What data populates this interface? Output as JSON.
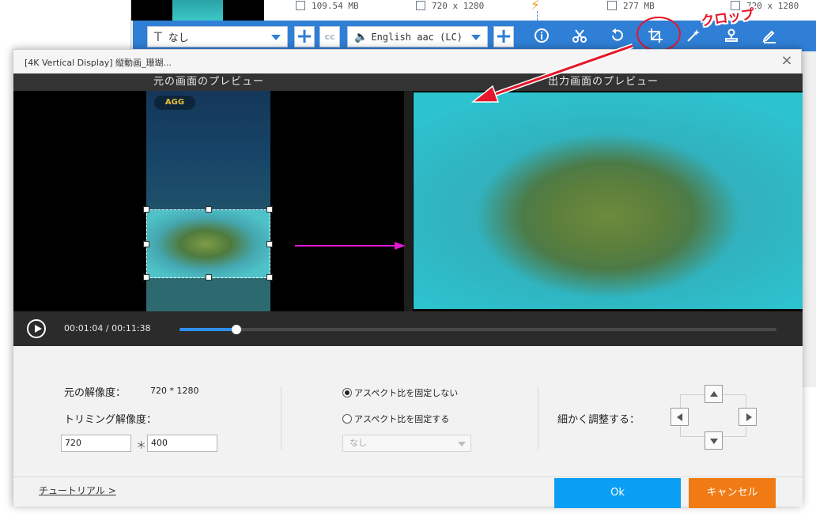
{
  "background_app": {
    "file_row": {
      "size_left": "109.54 MB",
      "res_left": "720 x 1280",
      "size_right": "277 MB",
      "res_right": "720 x 1280"
    },
    "toolbar": {
      "subtitle_select": "なし",
      "audio_select": "English aac (LC)",
      "plus_glyph": "+",
      "cc_glyph": "cc",
      "icons": [
        "info-icon",
        "scissors-icon",
        "rotate-icon",
        "crop-icon",
        "magic-wand-icon",
        "watermark-icon",
        "edit-icon"
      ]
    },
    "annotation": {
      "callout": "クロップ"
    }
  },
  "dialog": {
    "title": "[4K Vertical Display] 縦動画_珊瑚...",
    "close_glyph": "×",
    "preview": {
      "source_header": "元の画面のプレビュー",
      "output_header": "出力画面のプレビュー",
      "logo_text": "AGG"
    },
    "player": {
      "time_current": "00:01:04",
      "time_separator": "/",
      "time_total": "00:11:38",
      "progress": 0.095
    },
    "settings": {
      "orig_res_label": "元の解像度：",
      "orig_res_value": "720 * 1280",
      "trim_res_label": "トリミング解像度：",
      "trim_width": "720",
      "trim_multiply": "＊",
      "trim_height": "400",
      "radio_free": "アスペクト比を固定しない",
      "radio_fixed": "アスペクト比を固定する",
      "ratio_select": "なし",
      "fine_adjust_label": "細かく調整する："
    },
    "footer": {
      "tutorial_link": "チュートリアル >",
      "ok_label": "Ok",
      "cancel_label": "キャンセル"
    }
  },
  "colors": {
    "toolbar_blue": "#2f7fd6",
    "ok_blue": "#0a9ff5",
    "cancel_orange": "#f07a14",
    "annotation_red": "#e5172b",
    "arrow_magenta": "#e01ad0"
  }
}
